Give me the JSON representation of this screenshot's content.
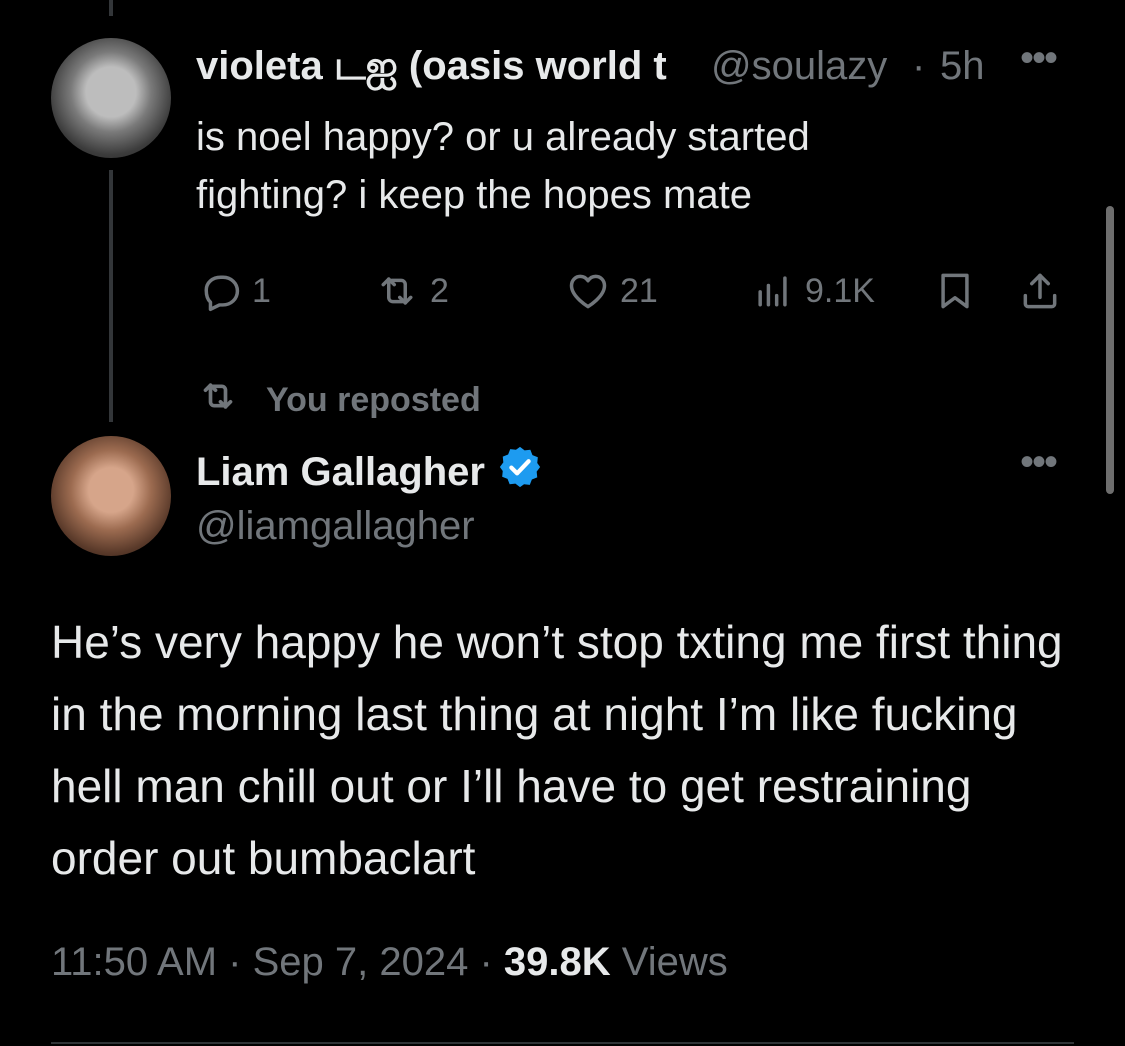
{
  "parent_tweet": {
    "display_name": "violeta டஐ (oasis world t",
    "handle": "@soulazy",
    "separator": "·",
    "time": "5h",
    "more": "•••",
    "text": "is noel happy? or u already started fighting? i keep the hopes mate",
    "actions": {
      "reply_count": "1",
      "repost_count": "2",
      "like_count": "21",
      "views_count": "9.1K"
    }
  },
  "repost_label": "You reposted",
  "main_tweet": {
    "display_name": "Liam Gallagher",
    "handle": "@liamgallagher",
    "more": "•••",
    "text": "He’s very happy he won’t stop txting me first thing in the morning last thing at night I’m like fucking hell man chill out or I’ll have to get restraining order out bumbaclart",
    "meta": {
      "time": "11:50 AM",
      "dot1": " · ",
      "date": "Sep 7, 2024",
      "dot2": " · ",
      "views_count": "39.8K",
      "views_label": " Views"
    }
  },
  "colors": {
    "background": "#000000",
    "text": "#e7e9ea",
    "muted": "#71767b",
    "verified": "#1d9bf0"
  },
  "icons": [
    "reply-icon",
    "repost-icon",
    "like-icon",
    "views-icon",
    "bookmark-icon",
    "share-icon",
    "verified-badge-icon",
    "more-icon"
  ]
}
